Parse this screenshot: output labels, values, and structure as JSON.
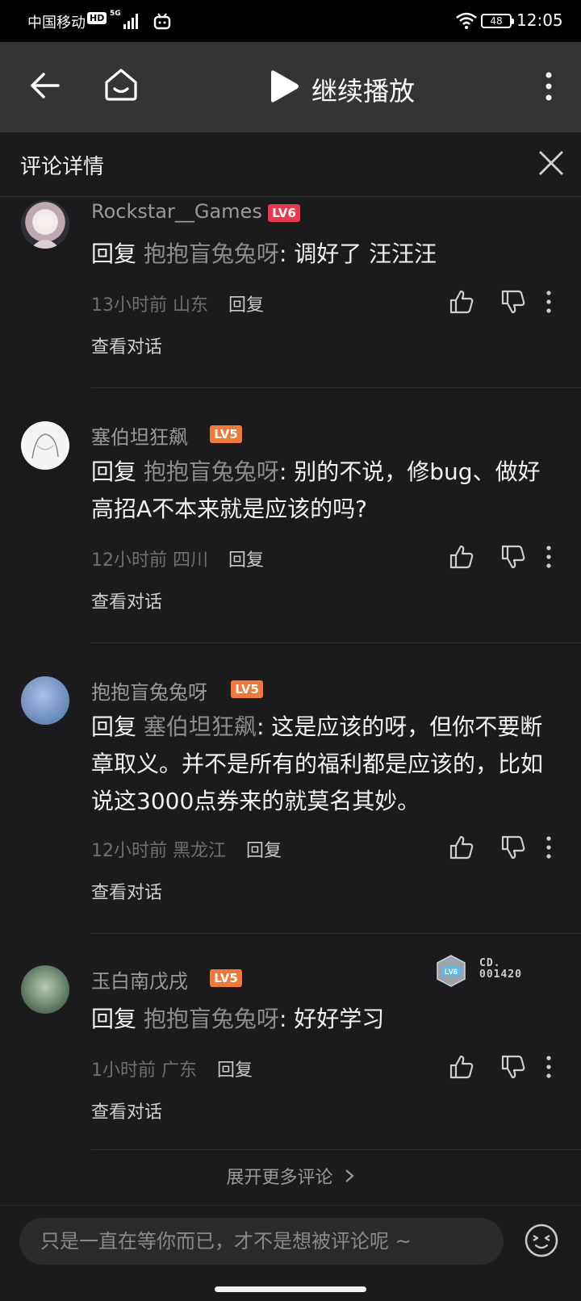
{
  "status_bar": {
    "carrier": "中国移动",
    "hd": "HD",
    "network": "5G",
    "battery": "48",
    "time": "12:05",
    "icons": [
      "signal-icon",
      "bilibili-tv-icon",
      "wifi-icon",
      "battery-icon"
    ]
  },
  "top_bar": {
    "title": "继续播放",
    "icons": [
      "back-icon",
      "home-icon",
      "play-icon",
      "more-vertical-icon"
    ]
  },
  "panel": {
    "title": "评论详情",
    "close_icon": "close-icon"
  },
  "reply_keyword": "回复",
  "reply_button": "回复",
  "view_conversation": "查看对话",
  "comments": [
    {
      "username": "Rockstar__Games",
      "level": "LV6",
      "mention": "抱抱盲兔兔呀",
      "text": ": 调好了 汪汪汪",
      "time": "13小时前",
      "location": "山东"
    },
    {
      "username": "塞伯坦狂飙",
      "level": "LV5",
      "mention": "抱抱盲兔兔呀",
      "text": ": 别的不说，修bug、做好高招A不本来就是应该的吗?",
      "time": "12小时前",
      "location": "四川"
    },
    {
      "username": "抱抱盲兔兔呀",
      "level": "LV5",
      "mention": "塞伯坦狂飙",
      "text": ": 这是应该的呀，但你不要断章取义。并不是所有的福利都是应该的，比如说这3000点券来的就莫名其妙。",
      "time": "12小时前",
      "location": "黑龙江"
    },
    {
      "username": "玉白南戊戌",
      "level": "LV5",
      "mention": "抱抱盲兔兔呀",
      "text": ": 好好学习",
      "time": "1小时前",
      "location": "广东",
      "badge_level": "LV6",
      "badge_code_line1": "CD.",
      "badge_code_line2": "001420"
    }
  ],
  "expand_more": "展开更多评论",
  "input": {
    "placeholder": "只是一直在等你而已，才不是想被评论呢 ~"
  },
  "colors": {
    "background": "#1b1b1d",
    "topbar": "#343434",
    "lv6": "#e8394f",
    "lv5": "#f0793a",
    "mention": "#8e8e8e"
  }
}
